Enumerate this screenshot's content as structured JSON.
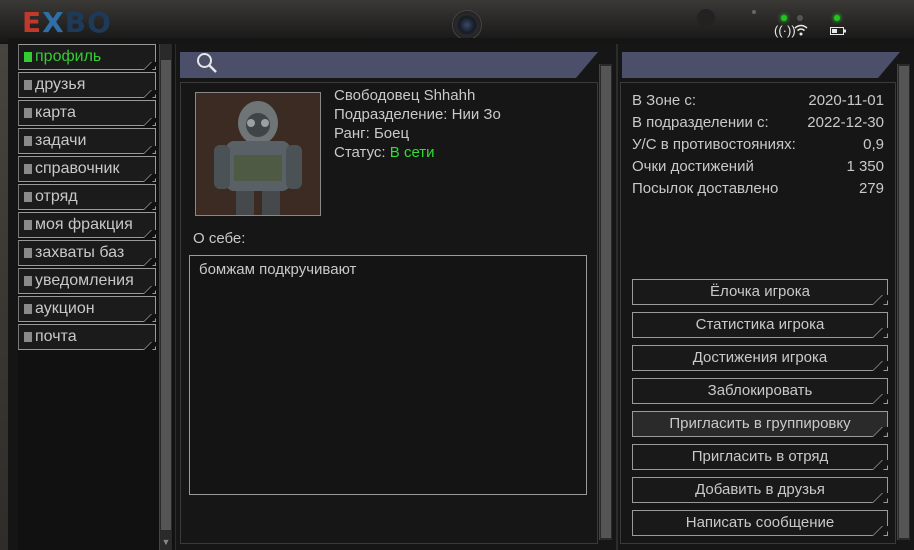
{
  "app": {
    "logo_part1": "E",
    "logo_part2": "X",
    "logo_part3": "BO"
  },
  "status_icons": [
    "antenna-icon",
    "wifi-icon",
    "battery-icon"
  ],
  "sidebar": {
    "items": [
      {
        "label": "профиль",
        "active": true
      },
      {
        "label": "друзья",
        "active": false
      },
      {
        "label": "карта",
        "active": false
      },
      {
        "label": "задачи",
        "active": false
      },
      {
        "label": "справочник",
        "active": false
      },
      {
        "label": "отряд",
        "active": false
      },
      {
        "label": "моя фракция",
        "active": false
      },
      {
        "label": "захваты баз",
        "active": false
      },
      {
        "label": "уведомления",
        "active": false
      },
      {
        "label": "аукцион",
        "active": false
      },
      {
        "label": "почта",
        "active": false
      }
    ]
  },
  "profile": {
    "name": "Свободовец Shhahh",
    "unit": "Подразделение: Нии Зо",
    "rank": "Ранг: Боец",
    "status_label": "Статус: ",
    "status_value": "В сети",
    "about_label": "О себе:",
    "about_text": "бомжам подкручивают"
  },
  "stats": [
    {
      "label": "В Зоне с:",
      "value": "2020-11-01"
    },
    {
      "label": "В подразделении с:",
      "value": "2022-12-30"
    },
    {
      "label": "У/С в противостояниях:",
      "value": "0,9"
    },
    {
      "label": "Очки достижений",
      "value": "1 350"
    },
    {
      "label": "Посылок доставлено",
      "value": "279"
    }
  ],
  "actions": [
    "Ёлочка игрока",
    "Статистика игрока",
    "Достижения игрока",
    "Заблокировать",
    "Пригласить в группировку",
    "Пригласить в отряд",
    "Добавить в друзья",
    "Написать сообщение"
  ],
  "colors": {
    "accent_online": "#33dd33",
    "header_bar": "#4b4f6a"
  }
}
